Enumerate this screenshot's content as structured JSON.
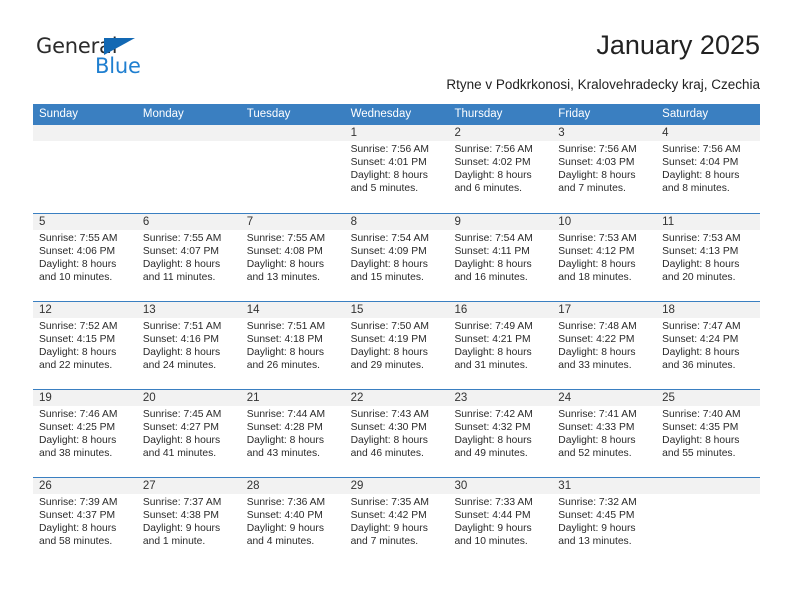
{
  "brand": {
    "general": "General",
    "blue": "Blue",
    "triangle_color": "#1268b3",
    "blue_color": "#1f7fd0"
  },
  "header": {
    "title": "January 2025",
    "subtitle": "Rtyne v Podkrkonosi, Kralovehradecky kraj, Czechia"
  },
  "theme": {
    "header_bar": "#3a7fc1",
    "daynum_band": "#f2f2f2",
    "text": "#2a2a2a"
  },
  "calendar": {
    "weekday_headers": [
      "Sunday",
      "Monday",
      "Tuesday",
      "Wednesday",
      "Thursday",
      "Friday",
      "Saturday"
    ],
    "weeks": [
      [
        {
          "day": "",
          "lines": []
        },
        {
          "day": "",
          "lines": []
        },
        {
          "day": "",
          "lines": []
        },
        {
          "day": "1",
          "lines": [
            "Sunrise: 7:56 AM",
            "Sunset: 4:01 PM",
            "Daylight: 8 hours",
            "and 5 minutes."
          ]
        },
        {
          "day": "2",
          "lines": [
            "Sunrise: 7:56 AM",
            "Sunset: 4:02 PM",
            "Daylight: 8 hours",
            "and 6 minutes."
          ]
        },
        {
          "day": "3",
          "lines": [
            "Sunrise: 7:56 AM",
            "Sunset: 4:03 PM",
            "Daylight: 8 hours",
            "and 7 minutes."
          ]
        },
        {
          "day": "4",
          "lines": [
            "Sunrise: 7:56 AM",
            "Sunset: 4:04 PM",
            "Daylight: 8 hours",
            "and 8 minutes."
          ]
        }
      ],
      [
        {
          "day": "5",
          "lines": [
            "Sunrise: 7:55 AM",
            "Sunset: 4:06 PM",
            "Daylight: 8 hours",
            "and 10 minutes."
          ]
        },
        {
          "day": "6",
          "lines": [
            "Sunrise: 7:55 AM",
            "Sunset: 4:07 PM",
            "Daylight: 8 hours",
            "and 11 minutes."
          ]
        },
        {
          "day": "7",
          "lines": [
            "Sunrise: 7:55 AM",
            "Sunset: 4:08 PM",
            "Daylight: 8 hours",
            "and 13 minutes."
          ]
        },
        {
          "day": "8",
          "lines": [
            "Sunrise: 7:54 AM",
            "Sunset: 4:09 PM",
            "Daylight: 8 hours",
            "and 15 minutes."
          ]
        },
        {
          "day": "9",
          "lines": [
            "Sunrise: 7:54 AM",
            "Sunset: 4:11 PM",
            "Daylight: 8 hours",
            "and 16 minutes."
          ]
        },
        {
          "day": "10",
          "lines": [
            "Sunrise: 7:53 AM",
            "Sunset: 4:12 PM",
            "Daylight: 8 hours",
            "and 18 minutes."
          ]
        },
        {
          "day": "11",
          "lines": [
            "Sunrise: 7:53 AM",
            "Sunset: 4:13 PM",
            "Daylight: 8 hours",
            "and 20 minutes."
          ]
        }
      ],
      [
        {
          "day": "12",
          "lines": [
            "Sunrise: 7:52 AM",
            "Sunset: 4:15 PM",
            "Daylight: 8 hours",
            "and 22 minutes."
          ]
        },
        {
          "day": "13",
          "lines": [
            "Sunrise: 7:51 AM",
            "Sunset: 4:16 PM",
            "Daylight: 8 hours",
            "and 24 minutes."
          ]
        },
        {
          "day": "14",
          "lines": [
            "Sunrise: 7:51 AM",
            "Sunset: 4:18 PM",
            "Daylight: 8 hours",
            "and 26 minutes."
          ]
        },
        {
          "day": "15",
          "lines": [
            "Sunrise: 7:50 AM",
            "Sunset: 4:19 PM",
            "Daylight: 8 hours",
            "and 29 minutes."
          ]
        },
        {
          "day": "16",
          "lines": [
            "Sunrise: 7:49 AM",
            "Sunset: 4:21 PM",
            "Daylight: 8 hours",
            "and 31 minutes."
          ]
        },
        {
          "day": "17",
          "lines": [
            "Sunrise: 7:48 AM",
            "Sunset: 4:22 PM",
            "Daylight: 8 hours",
            "and 33 minutes."
          ]
        },
        {
          "day": "18",
          "lines": [
            "Sunrise: 7:47 AM",
            "Sunset: 4:24 PM",
            "Daylight: 8 hours",
            "and 36 minutes."
          ]
        }
      ],
      [
        {
          "day": "19",
          "lines": [
            "Sunrise: 7:46 AM",
            "Sunset: 4:25 PM",
            "Daylight: 8 hours",
            "and 38 minutes."
          ]
        },
        {
          "day": "20",
          "lines": [
            "Sunrise: 7:45 AM",
            "Sunset: 4:27 PM",
            "Daylight: 8 hours",
            "and 41 minutes."
          ]
        },
        {
          "day": "21",
          "lines": [
            "Sunrise: 7:44 AM",
            "Sunset: 4:28 PM",
            "Daylight: 8 hours",
            "and 43 minutes."
          ]
        },
        {
          "day": "22",
          "lines": [
            "Sunrise: 7:43 AM",
            "Sunset: 4:30 PM",
            "Daylight: 8 hours",
            "and 46 minutes."
          ]
        },
        {
          "day": "23",
          "lines": [
            "Sunrise: 7:42 AM",
            "Sunset: 4:32 PM",
            "Daylight: 8 hours",
            "and 49 minutes."
          ]
        },
        {
          "day": "24",
          "lines": [
            "Sunrise: 7:41 AM",
            "Sunset: 4:33 PM",
            "Daylight: 8 hours",
            "and 52 minutes."
          ]
        },
        {
          "day": "25",
          "lines": [
            "Sunrise: 7:40 AM",
            "Sunset: 4:35 PM",
            "Daylight: 8 hours",
            "and 55 minutes."
          ]
        }
      ],
      [
        {
          "day": "26",
          "lines": [
            "Sunrise: 7:39 AM",
            "Sunset: 4:37 PM",
            "Daylight: 8 hours",
            "and 58 minutes."
          ]
        },
        {
          "day": "27",
          "lines": [
            "Sunrise: 7:37 AM",
            "Sunset: 4:38 PM",
            "Daylight: 9 hours",
            "and 1 minute."
          ]
        },
        {
          "day": "28",
          "lines": [
            "Sunrise: 7:36 AM",
            "Sunset: 4:40 PM",
            "Daylight: 9 hours",
            "and 4 minutes."
          ]
        },
        {
          "day": "29",
          "lines": [
            "Sunrise: 7:35 AM",
            "Sunset: 4:42 PM",
            "Daylight: 9 hours",
            "and 7 minutes."
          ]
        },
        {
          "day": "30",
          "lines": [
            "Sunrise: 7:33 AM",
            "Sunset: 4:44 PM",
            "Daylight: 9 hours",
            "and 10 minutes."
          ]
        },
        {
          "day": "31",
          "lines": [
            "Sunrise: 7:32 AM",
            "Sunset: 4:45 PM",
            "Daylight: 9 hours",
            "and 13 minutes."
          ]
        },
        {
          "day": "",
          "lines": []
        }
      ]
    ]
  }
}
